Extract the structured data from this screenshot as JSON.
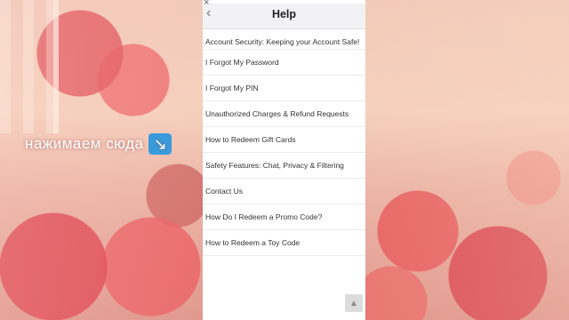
{
  "overlay": {
    "caption": "нажимаем сюда",
    "arrow": "↘"
  },
  "help": {
    "close_glyph": "×",
    "back_glyph": "‹",
    "title": "Help",
    "items": [
      "Account Security: Keeping your Account Safe!",
      "I Forgot My Password",
      "I Forgot My PIN",
      "Unauthorized Charges & Refund Requests",
      "How to Redeem Gift Cards",
      "Safety Features: Chat, Privacy & Filtering",
      "Contact Us",
      "How Do I Redeem a Promo Code?",
      "How to Redeem a Toy Code"
    ],
    "scroll_top_glyph": "▲"
  },
  "icons": {
    "close": "close-icon",
    "back": "chevron-left-icon",
    "arrow": "arrow-down-right-icon",
    "scroll_top": "scroll-to-top-icon"
  },
  "colors": {
    "panel_bg": "#ffffff",
    "header_bg": "#f2f2f4",
    "arrow_badge": "#3a9bdc"
  }
}
